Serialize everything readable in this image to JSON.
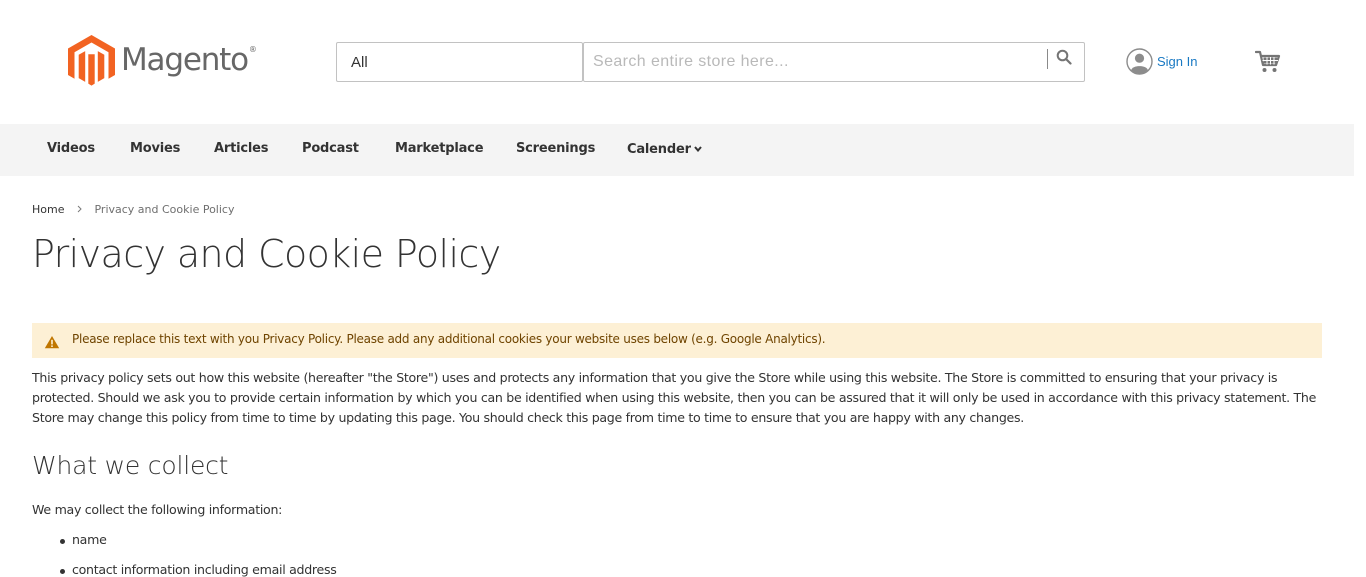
{
  "header": {
    "logo": {
      "name": "magento-logo",
      "text": "Magento",
      "mark": "®",
      "color": "#f26322"
    },
    "search": {
      "category_value": "All",
      "placeholder": "Search entire store here...",
      "button_icon": "search-icon"
    },
    "account": {
      "icon": "user-avatar-icon",
      "signin_label": "Sign In",
      "link_color": "#1979c3"
    },
    "cart": {
      "icon": "cart-icon"
    }
  },
  "nav": {
    "items": [
      {
        "label": "Videos"
      },
      {
        "label": "Movies"
      },
      {
        "label": "Articles"
      },
      {
        "label": "Podcast"
      },
      {
        "label": "Marketplace"
      },
      {
        "label": "Screenings"
      },
      {
        "label": "Calender",
        "icon": "chevron-down-icon"
      }
    ]
  },
  "breadcrumb": {
    "home": "Home",
    "current": "Privacy and Cookie Policy"
  },
  "page": {
    "title": "Privacy and Cookie Policy",
    "notice": {
      "icon": "warning-icon",
      "text": "Please replace this text with you Privacy Policy. Please add any additional cookies your website uses below (e.g. Google Analytics).",
      "bg_color": "#fdf0d5",
      "text_color": "#6f4400"
    },
    "intro": "This privacy policy sets out how this website (hereafter \"the Store\") uses and protects any information that you give the Store while using this website. The Store is committed to ensuring that your privacy is protected. Should we ask you to provide certain information by which you can be identified when using this website, then you can be assured that it will only be used in accordance with this privacy statement. The Store may change this policy from time to time by updating this page. You should check this page from time to time to ensure that you are happy with any changes.",
    "section_heading": "What we collect",
    "collect_intro": "We may collect the following information:",
    "collect_items": [
      "name",
      "contact information including email address"
    ]
  }
}
